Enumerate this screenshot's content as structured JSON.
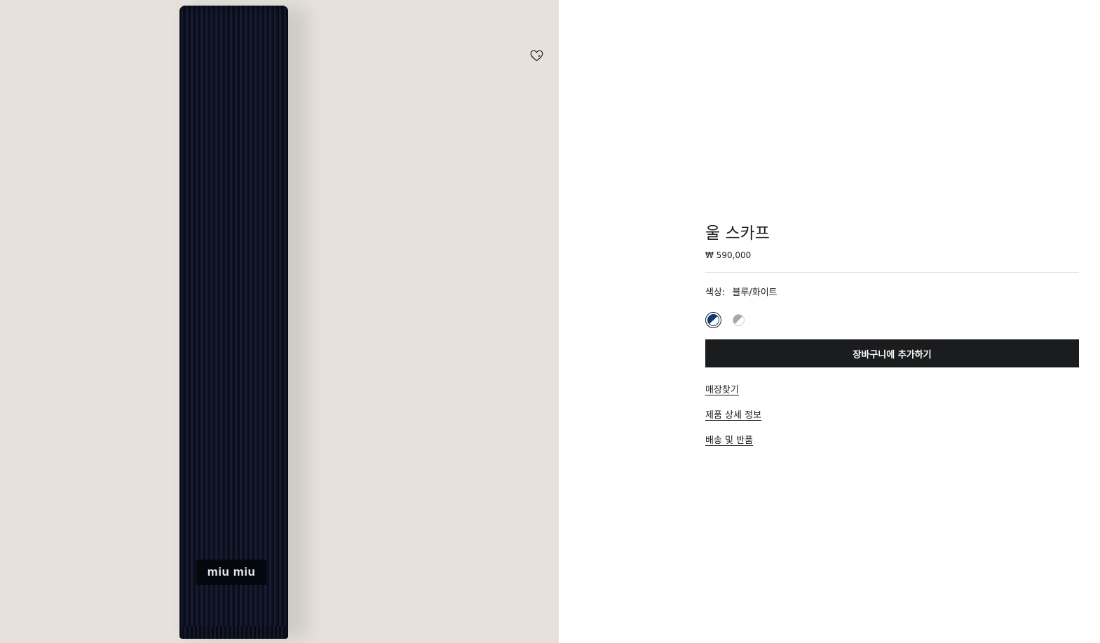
{
  "product": {
    "title": "울 스카프",
    "price": "₩ 590,000",
    "image_brand_label": "miu miu"
  },
  "color": {
    "label": "색상:",
    "selected_value": "블루/화이트",
    "swatches": [
      {
        "name": "blue-white",
        "colors": [
          "#0f3a6e",
          "#ffffff"
        ],
        "selected": true
      },
      {
        "name": "grey-white",
        "colors": [
          "#a7a7a7",
          "#ffffff"
        ],
        "selected": false
      }
    ]
  },
  "actions": {
    "add_to_bag": "장바구니에 추가하기"
  },
  "links": {
    "find_store": "매장찾기",
    "product_details": "제품 상세 정보",
    "shipping_returns": "배송 및 반품"
  },
  "icons": {
    "wishlist": "heart-icon"
  },
  "colors": {
    "image_background": "#e6e2db",
    "button_background": "#1b1c1e",
    "text": "#1b1c1e"
  }
}
